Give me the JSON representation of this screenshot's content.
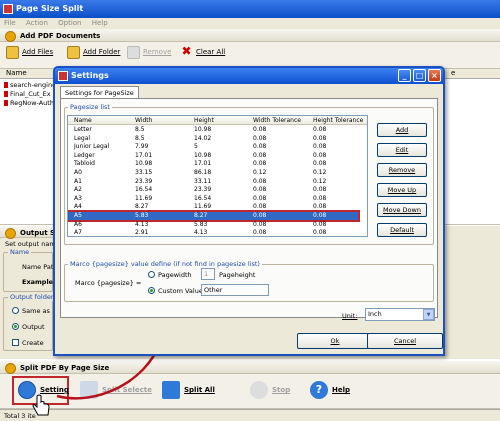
{
  "app": {
    "title": "Page Size Split"
  },
  "menu": [
    "File",
    "Action",
    "Option",
    "Help"
  ],
  "add_section": {
    "title": "Add PDF Documents"
  },
  "toolbar": {
    "add_files": "Add Files",
    "add_folder": "Add Folder",
    "remove": "Remove",
    "clear_all": "Clear All"
  },
  "file_list": {
    "col_name": "Name",
    "col_right": "e",
    "items": [
      "search-engine",
      "Final_Cut_Ex",
      "RegNow-Auth"
    ]
  },
  "output_section": {
    "title": "Output Se",
    "set_output": "Set output name",
    "name_group": "Name",
    "name_pattern_label": "Name Patte",
    "example_label": "Example:",
    "output_folder_group": "Output folder",
    "same_as": "Same as",
    "output_to": "Output",
    "create": "Create"
  },
  "split_section": {
    "title": "Split PDF By Page Size"
  },
  "bottom_buttons": {
    "setting": "Setting",
    "split_selected": "Split Selecte",
    "split_all": "Split All",
    "stop": "Stop",
    "help": "Help"
  },
  "status": {
    "text": "Total 3 ite"
  },
  "dialog": {
    "title": "Settings",
    "tab": "Settings for PageSize",
    "list_group": "Pagesize list",
    "columns": [
      "Name",
      "Width",
      "Height",
      "Width Tolerance",
      "Height Tolerance"
    ],
    "rows": [
      [
        "Letter",
        "8.5",
        "10.98",
        "0.08",
        "0.08"
      ],
      [
        "Legal",
        "8.5",
        "14.02",
        "0.08",
        "0.08"
      ],
      [
        "Junior Legal",
        "7.99",
        "5",
        "0.08",
        "0.08"
      ],
      [
        "Ledger",
        "17.01",
        "10.98",
        "0.08",
        "0.08"
      ],
      [
        "Tabloid",
        "10.98",
        "17.01",
        "0.08",
        "0.08"
      ],
      [
        "A0",
        "33.15",
        "86.18",
        "0.12",
        "0.12"
      ],
      [
        "A1",
        "23.39",
        "33.11",
        "0.08",
        "0.12"
      ],
      [
        "A2",
        "16.54",
        "23.39",
        "0.08",
        "0.08"
      ],
      [
        "A3",
        "11.69",
        "16.54",
        "0.08",
        "0.08"
      ],
      [
        "A4",
        "8.27",
        "11.69",
        "0.08",
        "0.08"
      ],
      [
        "A5",
        "5.83",
        "8.27",
        "0.08",
        "0.08"
      ],
      [
        "A6",
        "4.13",
        "5.83",
        "0.08",
        "0.08"
      ],
      [
        "A7",
        "2.91",
        "4.13",
        "0.08",
        "0.08"
      ]
    ],
    "selected_index": 10,
    "buttons": {
      "add": "Add",
      "edit": "Edit",
      "remove": "Remove",
      "move_up": "Move Up",
      "move_down": "Move Down",
      "default": "Default"
    },
    "marco_group": "Marco {pagesize} value define (if not find in pagesize list)",
    "marco_label": "Marco {pagesize} =",
    "pagewidth_label": "Pagewidth",
    "pagewidth_value": "1",
    "pageheight_label": "Pageheight",
    "custom_label": "Custom Value:",
    "custom_value": "Other",
    "unit_label": "Unit:",
    "unit_value": "Inch",
    "ok": "Ok",
    "cancel": "Cancel"
  },
  "colors": {
    "accent": "#0a4fc8",
    "highlight": "#c0272d",
    "selection": "#316ac5"
  }
}
